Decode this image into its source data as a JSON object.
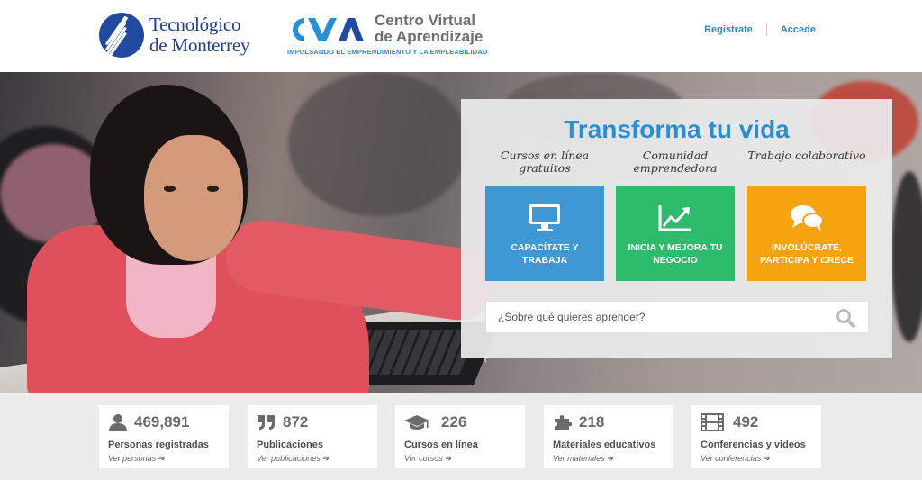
{
  "header": {
    "brand_line1": "Tecnológico",
    "brand_line2": "de Monterrey",
    "cva_title_line1": "Centro Virtual",
    "cva_title_line2": "de Aprendizaje",
    "cva_tagline": "IMPULSANDO EL EMPRENDIMIENTO Y LA EMPLEABILIDAD",
    "nav": {
      "register": "Registrate",
      "login": "Accede"
    }
  },
  "hero": {
    "title": "Transforma tu vida",
    "features": [
      {
        "label": "Cursos en línea gratuitos",
        "tile": "CAPACÍTATE Y TRABAJA",
        "color": "#3f97d3",
        "icon": "monitor-icon"
      },
      {
        "label": "Comunidad emprendedora",
        "tile": "INICIA Y MEJORA TU NEGOCIO",
        "color": "#2dbb6c",
        "icon": "chart-line-icon"
      },
      {
        "label": "Trabajo colaborativo",
        "tile": "INVOLÚCRATE, PARTICIPA Y CRECE",
        "color": "#f7a20f",
        "icon": "chat-bubbles-icon"
      }
    ],
    "search_placeholder": "¿Sobre qué quieres aprender?"
  },
  "stats": [
    {
      "number": "469,891",
      "label": "Personas registradas",
      "link": "Ver personas",
      "icon": "user-icon"
    },
    {
      "number": "872",
      "label": "Publicaciones",
      "link": "Ver publicaciones",
      "icon": "quote-icon"
    },
    {
      "number": "226",
      "label": "Cursos en línea",
      "link": "Ver cursos",
      "icon": "graduation-cap-icon"
    },
    {
      "number": "218",
      "label": "Materiales educativos",
      "link": "Ver materiales",
      "icon": "puzzle-icon"
    },
    {
      "number": "492",
      "label": "Conferencias y videos",
      "link": "Ver conferencias",
      "icon": "film-icon"
    }
  ],
  "colors": {
    "accent": "#2a8fd0",
    "brand": "#1f4aa0"
  }
}
